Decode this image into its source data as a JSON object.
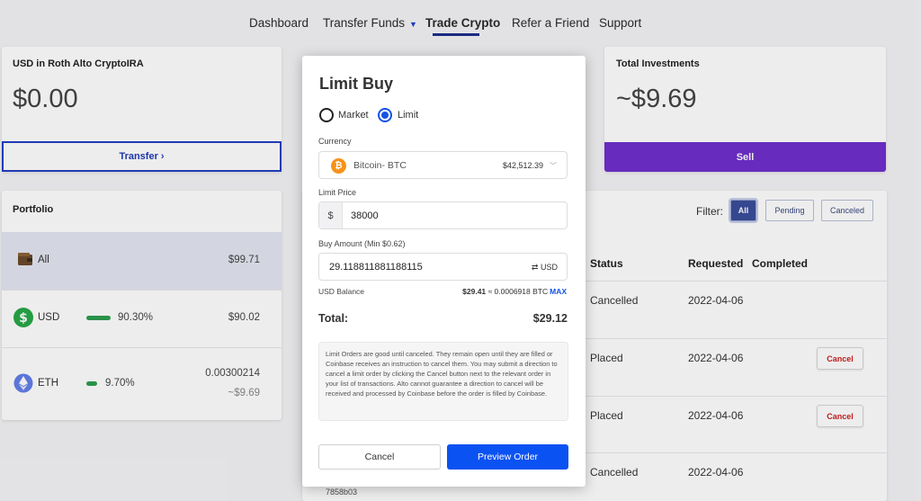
{
  "nav": {
    "items": [
      "Dashboard",
      "Transfer Funds",
      "Trade Crypto",
      "Refer a Friend",
      "Support"
    ],
    "active": "Trade Crypto"
  },
  "usd_card": {
    "title": "USD in Roth Alto CryptoIRA",
    "amount": "$0.00",
    "button": "Transfer"
  },
  "investments_card": {
    "title": "Total Investments",
    "amount": "~$9.69",
    "button": "Sell"
  },
  "portfolio": {
    "title": "Portfolio",
    "rows": [
      {
        "label": "All",
        "value": "$99.71",
        "icon": "wallet-icon"
      },
      {
        "label": "USD",
        "pct": "90.30%",
        "pct_value": 90.3,
        "value": "$90.02",
        "icon": "dollar-coin-icon"
      },
      {
        "label": "ETH",
        "pct": "9.70%",
        "pct_value": 9.7,
        "value": "0.00300214",
        "sub_value": "~$9.69",
        "icon": "ethereum-icon"
      }
    ]
  },
  "orders": {
    "filter_label": "Filter:",
    "filters": [
      "All",
      "Pending",
      "Canceled"
    ],
    "active_filter": "All",
    "headers": [
      "Status",
      "Requested",
      "Completed"
    ],
    "rows": [
      {
        "status": "Cancelled",
        "requested": "2022-04-06",
        "action": ""
      },
      {
        "status": "Placed",
        "requested": "2022-04-06",
        "action": "Cancel"
      },
      {
        "status": "Placed",
        "requested": "2022-04-06",
        "action": "Cancel"
      },
      {
        "status": "Cancelled",
        "requested": "2022-04-06",
        "action": ""
      }
    ],
    "partial_id": "7858b03"
  },
  "modal": {
    "title": "Limit Buy",
    "order_types": [
      "Market",
      "Limit"
    ],
    "selected_type": "Limit",
    "currency_label": "Currency",
    "currency_name": "Bitcoin- BTC",
    "currency_icon": "bitcoin-icon",
    "currency_price": "$42,512.39",
    "limit_price_label": "Limit Price",
    "limit_price_prefix": "$",
    "limit_price_value": "38000",
    "buy_amount_label": "Buy Amount (Min $0.62)",
    "buy_amount_value": "29.118811881188115",
    "buy_amount_unit": "USD",
    "balance_label": "USD Balance",
    "balance_usd": "$29.41",
    "balance_approx": "≈ 0.0006918 BTC",
    "balance_max": "MAX",
    "total_label": "Total:",
    "total_value": "$29.12",
    "note": "Limit Orders are good until canceled. They remain open until they are filled or Coinbase receives an instruction to cancel them. You may submit a direction to cancel a limit order by clicking the Cancel button next to the relevant order in your list of transactions. Alto cannot guarantee a direction to cancel will be received and processed by Coinbase before the order is filled by Coinbase.",
    "cancel_label": "Cancel",
    "preview_label": "Preview Order"
  },
  "colors": {
    "accent_blue": "#0b52f2",
    "nav_underline": "#1c2f8c",
    "sell_purple": "#6f2fcc",
    "bar_green": "#2e9e4f",
    "cancel_red": "#d01f1f",
    "bitcoin_orange": "#f7931a"
  }
}
